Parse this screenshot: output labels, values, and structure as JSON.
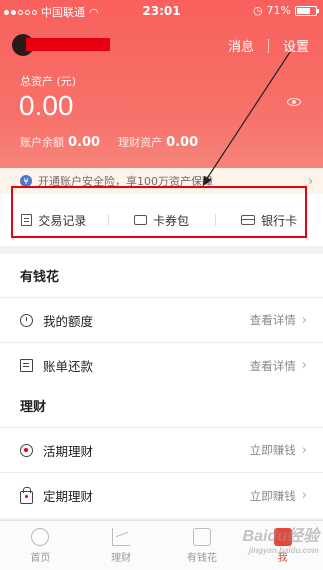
{
  "status_bar": {
    "carrier": "中国联通",
    "time": "23:01",
    "battery": "71%"
  },
  "header": {
    "top_links": [
      "消息",
      "设置"
    ],
    "total_assets_label": "总资产 (元)",
    "total_assets_value": "0.00",
    "balance_label": "账户余额",
    "balance_value": "0.00",
    "finance_label": "理财资产",
    "finance_value": "0.00"
  },
  "notice": {
    "text": "开通账户安全险，享100万资产保障"
  },
  "quick_links": [
    {
      "label": "交易记录",
      "icon": "document-icon"
    },
    {
      "label": "卡券包",
      "icon": "ticket-icon"
    },
    {
      "label": "银行卡",
      "icon": "card-icon"
    }
  ],
  "section_spend": {
    "title": "有钱花",
    "rows": [
      {
        "label": "我的额度",
        "action": "查看详情"
      },
      {
        "label": "账单还款",
        "action": "查看详情"
      }
    ]
  },
  "section_finance": {
    "title": "理财",
    "rows": [
      {
        "label": "活期理财",
        "action": "立即赚钱"
      },
      {
        "label": "定期理财",
        "action": "立即赚钱"
      }
    ]
  },
  "tabbar": {
    "tabs": [
      "首页",
      "理财",
      "有钱花",
      "我"
    ],
    "active": "我"
  },
  "watermark": {
    "brand": "Baidu经验",
    "url": "jingyan.baidu.com"
  },
  "colors": {
    "accent": "#f9605d",
    "highlight": "#e60012",
    "active_tab": "#e8483c"
  }
}
